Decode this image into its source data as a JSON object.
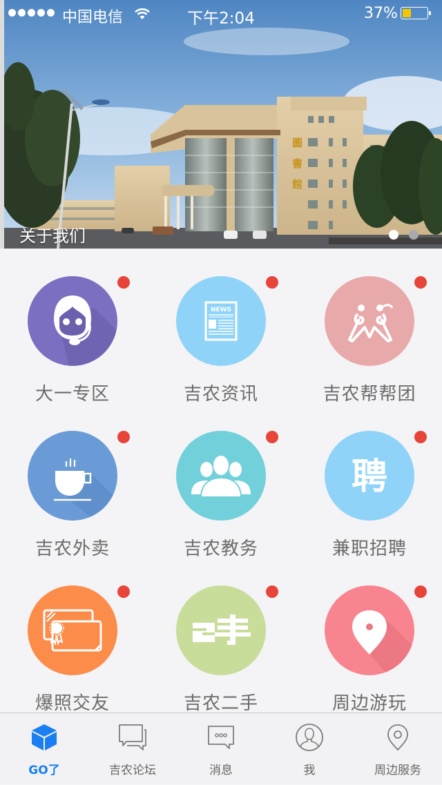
{
  "status_bar": {
    "signal_dots": 5,
    "carrier": "中国电信",
    "time": "下午2:04",
    "battery_percent_label": "37%",
    "battery_level": 0.37
  },
  "banner": {
    "caption": "关于我们",
    "building_sign": [
      "圖",
      "書",
      "館"
    ],
    "page_count": 2,
    "current_page": 1
  },
  "grid": {
    "badge_color": "#e7443a",
    "items": [
      {
        "label": "大一专区",
        "icon": "headset-avatar-icon",
        "color": "#7a6fc0",
        "badge": true
      },
      {
        "label": "吉农资讯",
        "icon": "newspaper-icon",
        "color": "#8fd4f8",
        "badge": true,
        "icon_text": "NEWS"
      },
      {
        "label": "吉农帮帮团",
        "icon": "helping-people-icon",
        "color": "#e8a9aa",
        "badge": true
      },
      {
        "label": "吉农外卖",
        "icon": "coffee-cup-icon",
        "color": "#6a9bd6",
        "badge": true
      },
      {
        "label": "吉农教务",
        "icon": "people-group-icon",
        "color": "#72d0da",
        "badge": true
      },
      {
        "label": "兼职招聘",
        "icon": "recruit-character-icon",
        "color": "#8fd4f8",
        "badge": true,
        "icon_text": "聘"
      },
      {
        "label": "爆照交友",
        "icon": "certificate-cards-icon",
        "color": "#fb8c4a",
        "badge": true
      },
      {
        "label": "吉农二手",
        "icon": "second-hand-icon",
        "color": "#c8dd9a",
        "badge": true,
        "icon_text": "2手"
      },
      {
        "label": "周边游玩",
        "icon": "map-pin-icon",
        "color": "#f8848f",
        "badge": true
      }
    ]
  },
  "tabbar": {
    "active_color": "#1a7ff0",
    "tabs": [
      {
        "label": "GO了",
        "icon": "cube-icon",
        "active": true
      },
      {
        "label": "吉农论坛",
        "icon": "chat-bubbles-icon",
        "active": false
      },
      {
        "label": "消息",
        "icon": "message-icon",
        "active": false
      },
      {
        "label": "我",
        "icon": "user-profile-icon",
        "active": false
      },
      {
        "label": "周边服务",
        "icon": "location-pin-icon",
        "active": false
      }
    ]
  }
}
